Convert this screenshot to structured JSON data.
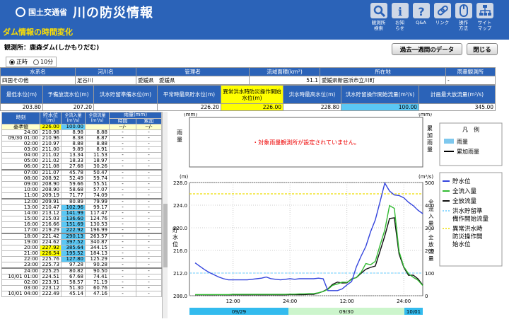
{
  "header": {
    "org": "国土交通省",
    "title": "川の防災情報",
    "subtitle": "ダム情報の時間変化"
  },
  "nav": [
    {
      "icon": "search-icon",
      "label": "観測所\n検索"
    },
    {
      "icon": "info-icon",
      "label": "お知\nらせ"
    },
    {
      "icon": "question-icon",
      "label": "Q&A"
    },
    {
      "icon": "link-icon",
      "label": "リンク"
    },
    {
      "icon": "mouse-icon",
      "label": "操作\n方法"
    },
    {
      "icon": "sitemap-icon",
      "label": "サイト\nマップ"
    }
  ],
  "station": "観測所：鹿森ダム(しかもりだむ)",
  "buttons": {
    "week": "過去一週間のデータ",
    "close": "閉じる"
  },
  "radio": {
    "opt1": "正時",
    "opt2": "10分"
  },
  "info1": {
    "headers": [
      "水系名",
      "河川名",
      "管理者",
      "流域面積(km²)",
      "所在地",
      "雨量観測所"
    ],
    "values": [
      "四国その他",
      "足谷川",
      "愛媛県　愛媛県",
      "51.1",
      "愛媛県新居浜市立川町",
      "-"
    ]
  },
  "info2": {
    "headers": [
      "最低水位(m)",
      "予備放流水位(m)",
      "洪水貯留準備水位(m)",
      "平常時最高貯水位(m)",
      "異常洪水時防災操作開始水位(m)",
      "洪水時最高水位(m)",
      "洪水貯留操作開始流量(m³/s)",
      "計画最大放流量(m³/s)"
    ],
    "values": [
      "203.80",
      "207.20",
      "",
      "226.20",
      "226.00",
      "228.80",
      "100.00",
      "345.00"
    ]
  },
  "table": {
    "headers": {
      "time": "時刻",
      "level": "貯水位\n(m)",
      "inflow": "全流入量\n(m³/s)",
      "outflow": "全放流量\n(m³/s)",
      "rain": "雨量(mm)",
      "rain_hour": "時間",
      "rain_cum": "累加"
    },
    "base": [
      "基準値",
      "226.00",
      "100.00",
      "",
      "--/-",
      "--/-"
    ],
    "rows": [
      [
        "24:00",
        "210.98",
        "8.98",
        "8.88",
        "-",
        "-"
      ],
      [
        "09/30 01:00",
        "210.96",
        "8.38",
        "8.87",
        "-",
        "-"
      ],
      [
        "02:00",
        "210.97",
        "8.88",
        "8.88",
        "-",
        "-"
      ],
      [
        "03:00",
        "211.00",
        "9.89",
        "8.91",
        "-",
        "-"
      ],
      [
        "04:00",
        "211.02",
        "13.34",
        "11.53",
        "-",
        "-"
      ],
      [
        "05:00",
        "211.02",
        "18.33",
        "18.97",
        "-",
        "-"
      ],
      [
        "06:00",
        "211.08",
        "27.68",
        "30.26",
        "-",
        "-"
      ],
      [
        "07:00",
        "211.07",
        "45.78",
        "50.47",
        "-",
        "-"
      ],
      [
        "08:00",
        "208.92",
        "52.49",
        "59.74",
        "-",
        "-"
      ],
      [
        "09:00",
        "208.90",
        "59.66",
        "55.51",
        "-",
        "-"
      ],
      [
        "10:00",
        "208.90",
        "58.68",
        "57.07",
        "-",
        "-"
      ],
      [
        "11:00",
        "209.19",
        "71.77",
        "74.09",
        "-",
        "-"
      ],
      [
        "12:00",
        "209.91",
        "80.89",
        "79.99",
        "-",
        "-"
      ],
      [
        "13:00",
        "210.47",
        "102.96",
        "99.17",
        "-",
        "-"
      ],
      [
        "14:00",
        "213.12",
        "141.99",
        "117.47",
        "-",
        "-"
      ],
      [
        "15:00",
        "215.03",
        "136.60",
        "124.76",
        "-",
        "-"
      ],
      [
        "16:00",
        "216.66",
        "151.69",
        "130.53",
        "-",
        "-"
      ],
      [
        "17:00",
        "219.29",
        "222.92",
        "196.99",
        "-",
        "-"
      ],
      [
        "18:00",
        "221.42",
        "290.13",
        "263.57",
        "-",
        "-"
      ],
      [
        "19:00",
        "224.62",
        "397.52",
        "340.87",
        "-",
        "-"
      ],
      [
        "20:00",
        "227.92",
        "385.64",
        "344.15",
        "-",
        "-"
      ],
      [
        "21:00",
        "226.54",
        "195.52",
        "184.13",
        "-",
        "-"
      ],
      [
        "22:00",
        "225.76",
        "127.80",
        "125.29",
        "-",
        "-"
      ],
      [
        "23:00",
        "225.73",
        "97.28",
        "90.28",
        "-",
        "-"
      ],
      [
        "24:00",
        "225.25",
        "80.82",
        "90.50",
        "-",
        "-"
      ],
      [
        "10/01 01:00",
        "224.51",
        "67.68",
        "74.41",
        "-",
        "-"
      ],
      [
        "02:00",
        "223.91",
        "58.57",
        "71.19",
        "-",
        "-"
      ],
      [
        "03:00",
        "223.12",
        "51.30",
        "60.76",
        "-",
        "-"
      ],
      [
        "10/01 04:00",
        "222.49",
        "45.14",
        "47.16",
        "-",
        "-"
      ]
    ]
  },
  "rain_chart": {
    "unit_left": "(mm)",
    "unit_right": "(mm)",
    "label_left": "雨\n量",
    "label_right": "累\n加\n雨\n量",
    "message": "・対象雨量観測所が設定されていません。"
  },
  "legend": {
    "title": "凡　例",
    "rain": "雨量",
    "cum": "累加雨量",
    "level": "貯水位",
    "inflow": "全流入量",
    "outflow": "全放流量",
    "flood_flow": "洪水貯留準\n備作開始流量",
    "abnormal": "異常洪水時\n防災操作開\n始水位"
  },
  "colors": {
    "header": "#2b63b8",
    "level": "#3344dd",
    "inflow": "#33bb33",
    "outflow": "#111111",
    "flood_flow": "#66ccff",
    "abnormal": "#eedd00",
    "rain": "#7ec8ee"
  },
  "chart_data": {
    "type": "line",
    "ylabel_left": "貯\n水\n位",
    "ylabel_right": "全\n流\n入\n量\n／\n全\n放\n流\n量",
    "unit_left": "(m)",
    "unit_right": "(m³/s)",
    "yleft_range": [
      208.0,
      228.0
    ],
    "yleft_ticks": [
      "208.0",
      "212.0",
      "216.0",
      "220.0",
      "224.0",
      "228.0"
    ],
    "yright_range": [
      0,
      500
    ],
    "yright_ticks": [
      "0",
      "100",
      "200",
      "300",
      "400",
      "500"
    ],
    "x_ticks": [
      "12:00",
      "24:00",
      "12:00",
      "24:00"
    ],
    "date_bands": [
      "09/29",
      "09/30",
      "10/01"
    ],
    "abnormal_level": 226.0,
    "flood_flow": 100.0,
    "level": [
      213.8,
      213.2,
      212.6,
      212.1,
      211.7,
      211.3,
      211.0,
      210.8,
      210.8,
      210.8,
      210.8,
      210.8,
      210.9,
      211.0,
      211.1,
      211.3,
      211.0,
      210.9,
      210.8,
      210.9,
      211.0,
      210.9,
      211.0,
      211.0,
      211.0,
      211.0,
      211.1,
      211.0,
      208.9,
      208.9,
      208.9,
      209.2,
      209.9,
      210.5,
      213.1,
      215.0,
      216.7,
      219.3,
      221.4,
      224.6,
      227.9,
      226.5,
      225.8,
      225.7,
      225.3,
      224.5,
      223.9,
      223.1,
      222.5
    ],
    "inflow": [
      5,
      5,
      5,
      5,
      5,
      5,
      5,
      5,
      6,
      6,
      6,
      6,
      6,
      6,
      6,
      6,
      6,
      6,
      6,
      6,
      7,
      7,
      8,
      8,
      9,
      9,
      13,
      18,
      28,
      46,
      52,
      60,
      59,
      72,
      81,
      103,
      142,
      137,
      152,
      223,
      290,
      398,
      386,
      196,
      128,
      97,
      81,
      68,
      45
    ],
    "outflow": [
      4,
      4,
      4,
      4,
      4,
      4,
      4,
      4,
      4,
      4,
      4,
      4,
      4,
      4,
      4,
      4,
      4,
      4,
      4,
      4,
      5,
      5,
      5,
      5,
      6,
      6,
      12,
      19,
      30,
      50,
      60,
      56,
      57,
      74,
      80,
      99,
      117,
      125,
      131,
      197,
      264,
      341,
      344,
      184,
      125,
      90,
      91,
      74,
      47
    ]
  }
}
